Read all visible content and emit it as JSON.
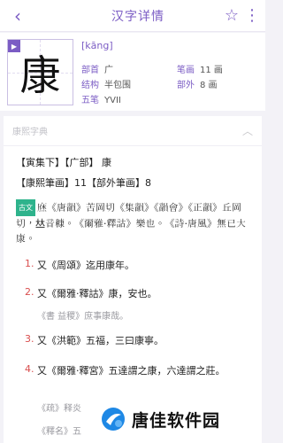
{
  "header": {
    "title": "汉字详情",
    "back_icon": "‹",
    "star_icon": "☆",
    "more_icon": "⋮"
  },
  "character": {
    "glyph": "康",
    "pinyin": "[kāng]",
    "play_icon": "▶",
    "fields": {
      "radical_label": "部首",
      "radical_value": "广",
      "strokes_label": "笔画",
      "strokes_value": "11 画",
      "structure_label": "结构",
      "structure_value": "半包围",
      "outside_label": "部外",
      "outside_value": "8 画",
      "wubi_label": "五笔",
      "wubi_value": "YVII"
    }
  },
  "dictionary": {
    "name": "康熙字典",
    "collapse_icon": "︿",
    "line1": "【寅集下】【广部】 康",
    "line2": "【康熙筆画】11【部外筆画】8",
    "tag": "古文",
    "intro": "𢊒《唐韻》苦岡切《集韻》《韻會》《正韻》丘岡切，𠀤音穅。《爾雅·釋詁》樂也。《詩·唐風》無已大康。",
    "definitions": [
      {
        "num": "1.",
        "text": "又《周頌》迄用康年。"
      },
      {
        "num": "2.",
        "text": "又《爾雅·釋詁》康，安也。",
        "quote": "《書 益稷》庶事康哉。"
      },
      {
        "num": "3.",
        "text": "又《洪範》五福，三曰康寧。"
      },
      {
        "num": "4.",
        "text": "又《爾雅·釋宮》五達謂之康，六達謂之莊。",
        "quote": "《疏》释炎"
      }
    ],
    "trailing_quote": "《釋名》五"
  },
  "watermark": {
    "text": "唐佳软件园"
  }
}
